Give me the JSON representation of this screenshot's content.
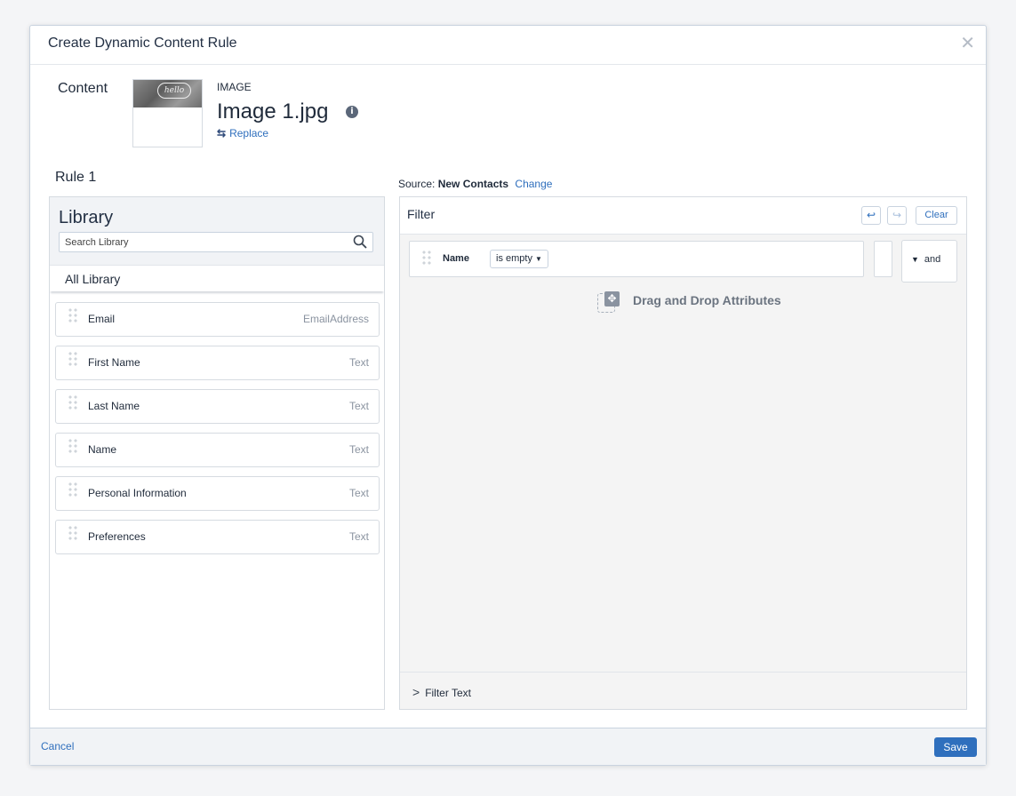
{
  "modal": {
    "title": "Create Dynamic Content Rule"
  },
  "content": {
    "label": "Content",
    "thumb_text": "hello",
    "asset_type": "IMAGE",
    "asset_name": "Image 1.jpg",
    "replace_label": "Replace"
  },
  "rule": {
    "label": "Rule 1"
  },
  "library": {
    "title": "Library",
    "search_placeholder": "Search Library",
    "all_label": "All Library",
    "items": [
      {
        "name": "Email",
        "type": "EmailAddress"
      },
      {
        "name": "First Name",
        "type": "Text"
      },
      {
        "name": "Last Name",
        "type": "Text"
      },
      {
        "name": "Name",
        "type": "Text"
      },
      {
        "name": "Personal Information",
        "type": "Text"
      },
      {
        "name": "Preferences",
        "type": "Text"
      }
    ]
  },
  "source": {
    "prefix": "Source:",
    "name": "New Contacts",
    "change_label": "Change"
  },
  "filter": {
    "title": "Filter",
    "clear_label": "Clear",
    "condition": {
      "attribute": "Name",
      "operator": "is empty"
    },
    "conjunction": "and",
    "drop_hint": "Drag and Drop Attributes",
    "filter_text_label": "Filter Text"
  },
  "footer": {
    "cancel_label": "Cancel",
    "save_label": "Save"
  },
  "icons": {
    "close": "close-icon",
    "info": "info-icon",
    "replace": "replace-icon",
    "search": "search-icon",
    "undo": "undo-icon",
    "redo": "redo-icon",
    "drag": "drag-handle-icon",
    "move": "move-icon",
    "chevron": "chevron-right-icon"
  },
  "colors": {
    "accent": "#2f6fbd",
    "panel_bg": "#f4f4f4",
    "header_bg": "#f1f3f6"
  }
}
